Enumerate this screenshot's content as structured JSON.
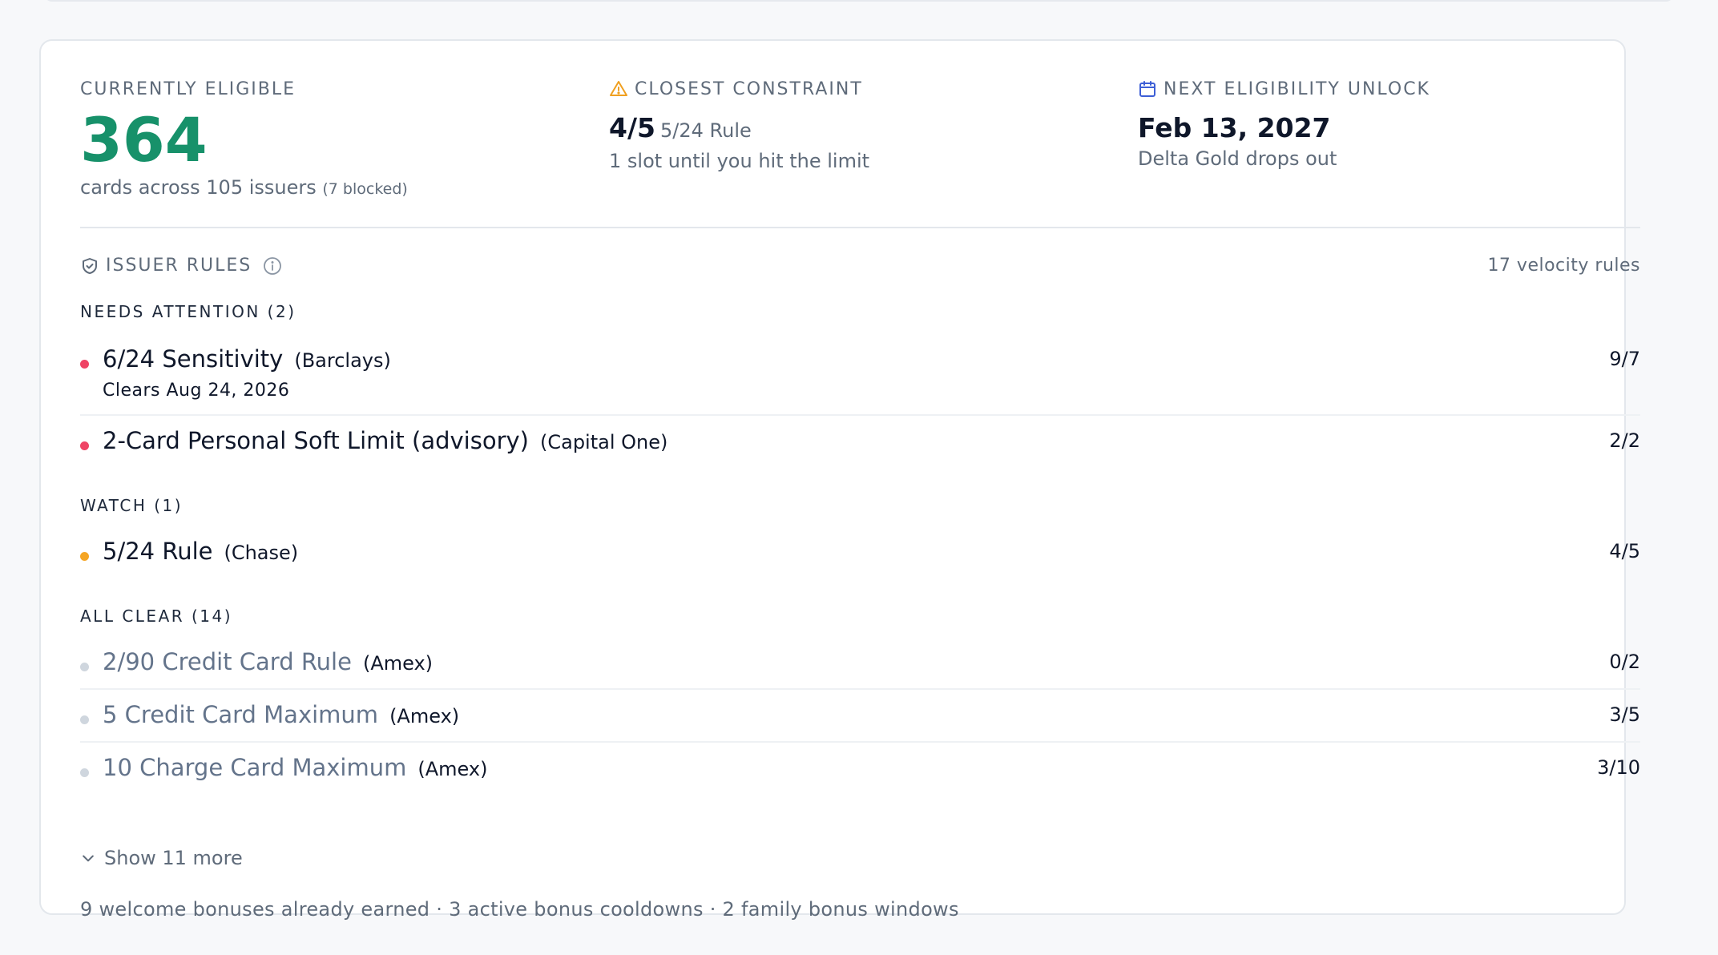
{
  "summary": {
    "eligible": {
      "label": "CURRENTLY ELIGIBLE",
      "count": "364",
      "sub_text": "cards across 105 issuers",
      "blocked_text": "(7 blocked)"
    },
    "constraint": {
      "label": "CLOSEST CONSTRAINT",
      "value": "4/5",
      "rule": "5/24 Rule",
      "note": "1 slot until you hit the limit"
    },
    "unlock": {
      "label": "NEXT ELIGIBILITY UNLOCK",
      "date": "Feb 13, 2027",
      "note": "Delta Gold drops out"
    }
  },
  "rules": {
    "title": "ISSUER RULES",
    "count_text": "17 velocity rules",
    "sections": {
      "attention": {
        "label": "NEEDS ATTENTION (2)",
        "items": [
          {
            "name": "6/24 Sensitivity",
            "issuer": "(Barclays)",
            "count": "9/7",
            "clears": "Clears Aug 24, 2026"
          },
          {
            "name": "2-Card Personal Soft Limit (advisory)",
            "issuer": "(Capital One)",
            "count": "2/2"
          }
        ]
      },
      "watch": {
        "label": "WATCH (1)",
        "items": [
          {
            "name": "5/24 Rule",
            "issuer": "(Chase)",
            "count": "4/5"
          }
        ]
      },
      "clear": {
        "label": "ALL CLEAR (14)",
        "items": [
          {
            "name": "2/90 Credit Card Rule",
            "issuer": "(Amex)",
            "count": "0/2"
          },
          {
            "name": "5 Credit Card Maximum",
            "issuer": "(Amex)",
            "count": "3/5"
          },
          {
            "name": "10 Charge Card Maximum",
            "issuer": "(Amex)",
            "count": "3/10"
          }
        ]
      }
    },
    "show_more": "Show 11 more"
  },
  "footer": "9 welcome bonuses already earned · 3 active bonus cooldowns · 2 family bonus windows",
  "colors": {
    "eligible_green": "#17916a",
    "attention_red": "#ef4465",
    "watch_amber": "#f5a524",
    "clear_gray": "#cfd6de",
    "icon_blue": "#3d5fd6",
    "warning_amber": "#f0a020"
  },
  "icons": {
    "constraint": "warning-triangle-icon",
    "unlock": "calendar-icon",
    "rules": "shield-check-icon",
    "info": "info-circle-icon",
    "show_more": "chevron-down-icon"
  }
}
